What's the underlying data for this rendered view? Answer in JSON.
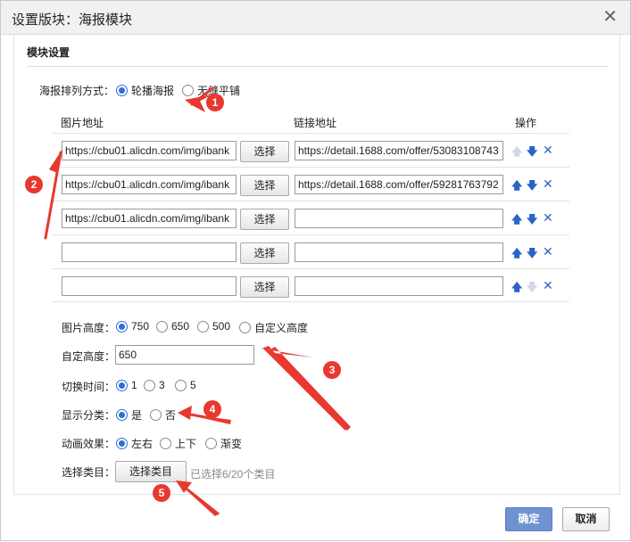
{
  "dialog": {
    "title": "设置版块：海报模块",
    "close_icon": "close-icon"
  },
  "section": {
    "title": "模块设置"
  },
  "layout_mode": {
    "label": "海报排列方式：",
    "options": [
      {
        "label": "轮播海报",
        "checked": true
      },
      {
        "label": "无缝平铺",
        "checked": false
      }
    ]
  },
  "table": {
    "headers": {
      "image": "图片地址",
      "link": "链接地址",
      "actions": "操作"
    },
    "select_label": "选择",
    "rows": [
      {
        "image": "https://cbu01.alicdn.com/img/ibank",
        "link": "https://detail.1688.com/offer/53083108743"
      },
      {
        "image": "https://cbu01.alicdn.com/img/ibank",
        "link": "https://detail.1688.com/offer/59281763792"
      },
      {
        "image": "https://cbu01.alicdn.com/img/ibank",
        "link": ""
      },
      {
        "image": "",
        "link": ""
      },
      {
        "image": "",
        "link": ""
      }
    ],
    "action_icons": {
      "up": "arrow-up-icon",
      "down": "arrow-down-icon",
      "delete": "delete-icon"
    },
    "colors": {
      "icon": "#2a64c4",
      "icon_disabled": "#cfd8e6"
    }
  },
  "image_height": {
    "label": "图片高度：",
    "options": [
      {
        "label": "750",
        "checked": true
      },
      {
        "label": "650",
        "checked": false
      },
      {
        "label": "500",
        "checked": false
      },
      {
        "label": "自定义高度",
        "checked": false
      }
    ]
  },
  "custom_height": {
    "label": "自定高度：",
    "value": "650"
  },
  "switch_time": {
    "label": "切换时间：",
    "options": [
      {
        "label": "1",
        "checked": true
      },
      {
        "label": "3",
        "checked": false
      },
      {
        "label": "5",
        "checked": false
      }
    ]
  },
  "show_category": {
    "label": "显示分类：",
    "options": [
      {
        "label": "是",
        "checked": true
      },
      {
        "label": "否",
        "checked": false
      }
    ]
  },
  "animation": {
    "label": "动画效果：",
    "options": [
      {
        "label": "左右",
        "checked": true
      },
      {
        "label": "上下",
        "checked": false
      },
      {
        "label": "渐变",
        "checked": false
      }
    ]
  },
  "category_select": {
    "label": "选择类目：",
    "button": "选择类目",
    "hint": "已选择6/20个类目"
  },
  "footer": {
    "ok": "确定",
    "cancel": "取消"
  },
  "annotations": {
    "badges": [
      "1",
      "2",
      "3",
      "4",
      "5"
    ],
    "color": "#e8382f"
  }
}
